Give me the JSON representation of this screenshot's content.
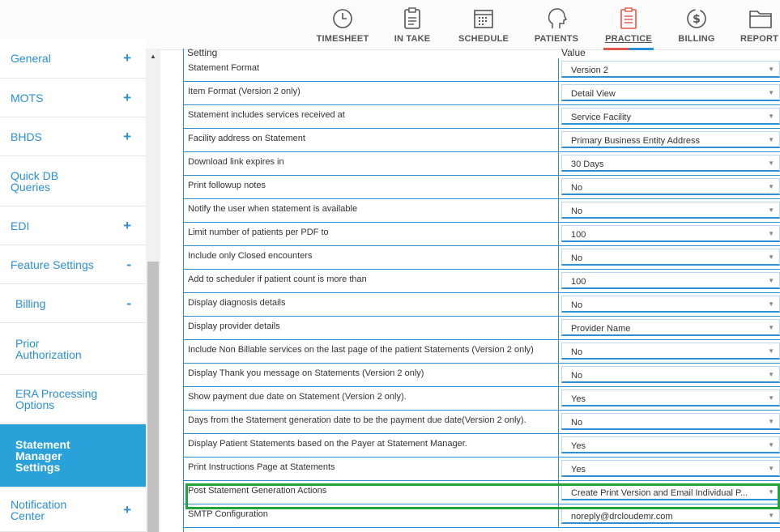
{
  "nav": {
    "items": [
      {
        "label": "TIMESHEET",
        "icon": "clock-icon"
      },
      {
        "label": "IN TAKE",
        "icon": "clipboard-icon"
      },
      {
        "label": "SCHEDULE",
        "icon": "calendar-icon"
      },
      {
        "label": "PATIENTS",
        "icon": "head-icon"
      },
      {
        "label": "PRACTICE",
        "icon": "checklist-icon"
      },
      {
        "label": "BILLING",
        "icon": "dollar-icon"
      },
      {
        "label": "REPORT",
        "icon": "folder-icon"
      }
    ],
    "active": "PRACTICE"
  },
  "sidebar": {
    "items": [
      {
        "label": "General",
        "toggle": "+"
      },
      {
        "label": "MOTS",
        "toggle": "+"
      },
      {
        "label": "BHDS",
        "toggle": "+"
      },
      {
        "label": "Quick DB Queries",
        "toggle": ""
      },
      {
        "label": "EDI",
        "toggle": "+"
      },
      {
        "label": "Feature Settings",
        "toggle": "-"
      },
      {
        "label": "Billing",
        "toggle": "-"
      },
      {
        "label": "Prior Authorization",
        "toggle": ""
      },
      {
        "label": "ERA Processing Options",
        "toggle": ""
      },
      {
        "label": "Statement Manager Settings",
        "toggle": ""
      },
      {
        "label": "Notification Center",
        "toggle": "+"
      }
    ],
    "active": "Statement Manager Settings"
  },
  "table": {
    "header_setting": "Setting",
    "header_value": "Value",
    "rows": [
      {
        "setting": "Statement Format",
        "value": "Version 2"
      },
      {
        "setting": "Item Format (Version 2 only)",
        "value": "Detail View"
      },
      {
        "setting": "Statement includes services received at",
        "value": "Service Facility"
      },
      {
        "setting": "Facility address on Statement",
        "value": "Primary Business Entity Address"
      },
      {
        "setting": "Download link expires in",
        "value": "30 Days"
      },
      {
        "setting": "Print followup notes",
        "value": "No"
      },
      {
        "setting": "Notify the user when statement is available",
        "value": "No"
      },
      {
        "setting": "Limit number of patients per PDF to",
        "value": "100"
      },
      {
        "setting": "Include only Closed encounters",
        "value": "No"
      },
      {
        "setting": "Add to scheduler if patient count is more than",
        "value": "100"
      },
      {
        "setting": "Display diagnosis details",
        "value": "No"
      },
      {
        "setting": "Display provider details",
        "value": "Provider Name"
      },
      {
        "setting": "Include Non Billable services on the last page of the patient Statements (Version 2 only)",
        "value": "No"
      },
      {
        "setting": "Display Thank you message on Statements (Version 2 only)",
        "value": "No"
      },
      {
        "setting": "Show payment due date on Statement (Version 2 only).",
        "value": "Yes"
      },
      {
        "setting": "Days from the Statement generation date to be the payment due date(Version 2 only).",
        "value": "No"
      },
      {
        "setting": "Display Patient Statements based on the Payer at Statement Manager.",
        "value": "Yes"
      },
      {
        "setting": "Print Instructions Page at Statements",
        "value": "Yes"
      },
      {
        "setting": "Post Statement Generation Actions",
        "value": "Create Print Version and Email Individual P..."
      },
      {
        "setting": "SMTP Configuration",
        "value": "noreply@drcloudemr.com"
      }
    ],
    "highlighted_row": "Post Statement Generation Actions"
  },
  "colors": {
    "accent": "#2a8fd4",
    "active_bg": "#2aa1d8",
    "highlight": "#21a338"
  }
}
